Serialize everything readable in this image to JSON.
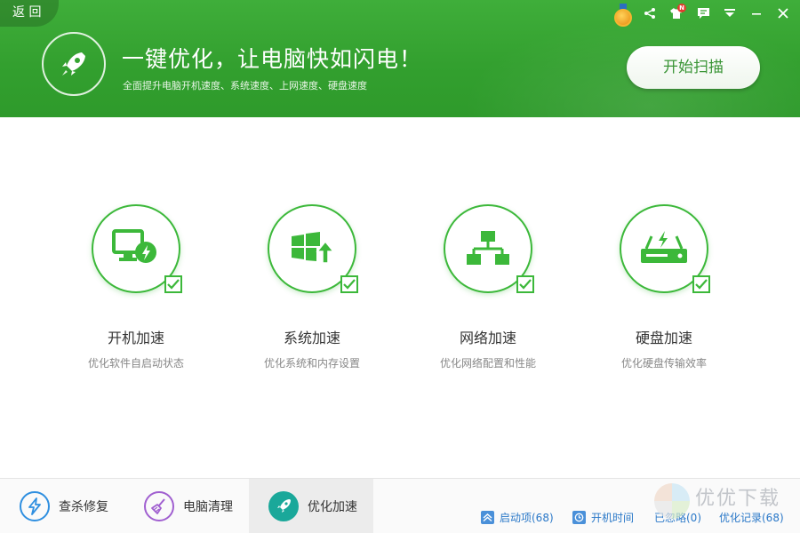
{
  "header": {
    "back_label": "返 回",
    "headline": "一键优化，让电脑快如闪电！",
    "subline": "全面提升电脑开机速度、系统速度、上网速度、硬盘速度",
    "scan_button": "开始扫描",
    "badge_letter": "N",
    "icons": [
      "medal-icon",
      "share-icon",
      "shirt-icon",
      "message-icon",
      "menu-icon",
      "minimize-icon",
      "close-icon"
    ]
  },
  "cards": [
    {
      "title": "开机加速",
      "desc": "优化软件自启动状态",
      "icon": "monitor-bolt-icon"
    },
    {
      "title": "系统加速",
      "desc": "优化系统和内存设置",
      "icon": "windows-up-icon"
    },
    {
      "title": "网络加速",
      "desc": "优化网络配置和性能",
      "icon": "network-icon"
    },
    {
      "title": "硬盘加速",
      "desc": "优化硬盘传输效率",
      "icon": "harddisk-icon"
    }
  ],
  "tabs": [
    {
      "label": "查杀修复",
      "color": "#2f8fe0"
    },
    {
      "label": "电脑清理",
      "color": "#a05fd0"
    },
    {
      "label": "优化加速",
      "color": "#1aa89a"
    }
  ],
  "status": {
    "startup": "启动项(68)",
    "boot_time": "开机时间",
    "ignored": "已忽略(0)",
    "records": "优化记录(68)"
  },
  "watermark": "优优下载",
  "colors": {
    "brand_green": "#3cb83a",
    "header_green": "#35a431",
    "link_blue": "#2a78c8"
  }
}
